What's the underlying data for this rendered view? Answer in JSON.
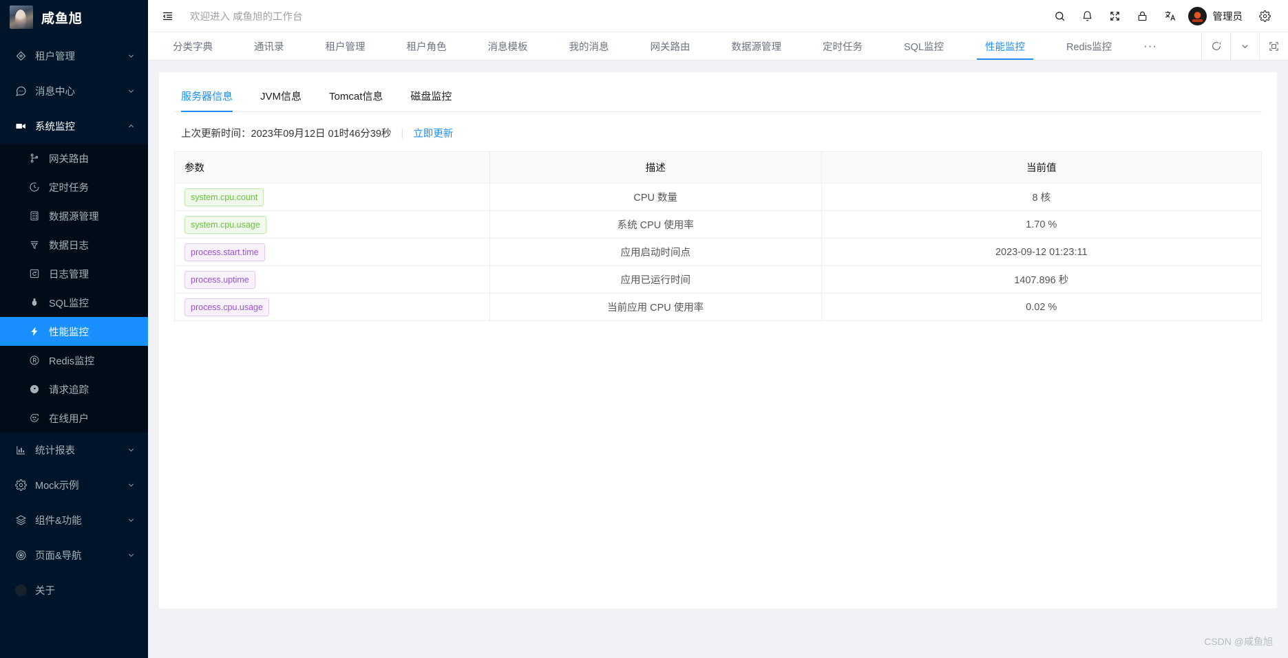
{
  "brand": {
    "name": "咸鱼旭",
    "logo_icon": "user-avatar-photo"
  },
  "sidebar": {
    "items": [
      {
        "label": "租户管理",
        "icon": "diamond-icon",
        "type": "group",
        "arrow": "chevron-down-icon"
      },
      {
        "label": "消息中心",
        "icon": "comment-dots-icon",
        "type": "group",
        "arrow": "chevron-down-icon"
      },
      {
        "label": "系统监控",
        "icon": "monitor-icon",
        "type": "group-open",
        "arrow": "chevron-up-icon"
      }
    ],
    "system_monitor_children": [
      {
        "label": "网关路由",
        "icon": "branch-icon",
        "active": false
      },
      {
        "label": "定时任务",
        "icon": "clock-icon",
        "active": false
      },
      {
        "label": "数据源管理",
        "icon": "database-icon",
        "active": false
      },
      {
        "label": "数据日志",
        "icon": "filter-icon",
        "active": false
      },
      {
        "label": "日志管理",
        "icon": "refresh-box-icon",
        "active": false
      },
      {
        "label": "SQL监控",
        "icon": "bug-icon",
        "active": false
      },
      {
        "label": "性能监控",
        "icon": "lightning-icon",
        "active": true
      },
      {
        "label": "Redis监控",
        "icon": "registered-icon",
        "active": false
      },
      {
        "label": "请求追踪",
        "icon": "compass-icon",
        "active": false
      },
      {
        "label": "在线用户",
        "icon": "smiley-icon",
        "active": false
      }
    ],
    "tail_items": [
      {
        "label": "统计报表",
        "icon": "bar-chart-icon",
        "type": "group",
        "arrow": "chevron-down-icon"
      },
      {
        "label": "Mock示例",
        "icon": "gear-icon",
        "type": "group",
        "arrow": "chevron-down-icon"
      },
      {
        "label": "组件&功能",
        "icon": "layers-icon",
        "type": "group",
        "arrow": "chevron-down-icon"
      },
      {
        "label": "页面&导航",
        "icon": "target-icon",
        "type": "group",
        "arrow": "chevron-down-icon"
      },
      {
        "label": "关于",
        "icon": "circle-dot-icon",
        "type": "leaf",
        "arrow": ""
      }
    ]
  },
  "topbar": {
    "collapse_icon": "menu-fold-icon",
    "welcome": "欢迎进入 咸鱼旭的工作台",
    "icons": [
      "search-icon",
      "bell-icon",
      "fullscreen-icon",
      "lock-icon",
      "translate-icon"
    ],
    "user_name": "管理员",
    "avatar_icon": "user-avatar",
    "settings_icon": "gear-icon"
  },
  "tabbar": {
    "tabs": [
      {
        "label": "分类字典",
        "active": false
      },
      {
        "label": "通讯录",
        "active": false
      },
      {
        "label": "租户管理",
        "active": false
      },
      {
        "label": "租户角色",
        "active": false
      },
      {
        "label": "消息模板",
        "active": false
      },
      {
        "label": "我的消息",
        "active": false
      },
      {
        "label": "网关路由",
        "active": false
      },
      {
        "label": "数据源管理",
        "active": false
      },
      {
        "label": "定时任务",
        "active": false
      },
      {
        "label": "SQL监控",
        "active": false
      },
      {
        "label": "性能监控",
        "active": true
      },
      {
        "label": "Redis监控",
        "active": false
      }
    ],
    "more_label": "···",
    "controls": [
      {
        "icon": "refresh-icon"
      },
      {
        "icon": "chevron-down-icon"
      },
      {
        "icon": "fullscreen-box-icon"
      }
    ]
  },
  "page": {
    "inner_tabs": [
      {
        "label": "服务器信息",
        "active": true
      },
      {
        "label": "JVM信息",
        "active": false
      },
      {
        "label": "Tomcat信息",
        "active": false
      },
      {
        "label": "磁盘监控",
        "active": false
      }
    ],
    "update_label": "上次更新时间：",
    "update_time": "2023年09月12日 01时46分39秒",
    "update_link": "立即更新",
    "table": {
      "columns": [
        "参数",
        "描述",
        "当前值"
      ],
      "rows": [
        {
          "param": "system.cpu.count",
          "tag_color": "green",
          "desc": "CPU 数量",
          "value": "8 核"
        },
        {
          "param": "system.cpu.usage",
          "tag_color": "green",
          "desc": "系统 CPU 使用率",
          "value": "1.70 %"
        },
        {
          "param": "process.start.time",
          "tag_color": "purple",
          "desc": "应用启动时间点",
          "value": "2023-09-12 01:23:11"
        },
        {
          "param": "process.uptime",
          "tag_color": "purple",
          "desc": "应用已运行时间",
          "value": "1407.896 秒"
        },
        {
          "param": "process.cpu.usage",
          "tag_color": "purple",
          "desc": "当前应用 CPU 使用率",
          "value": "0.02 %"
        }
      ]
    }
  },
  "watermark": "CSDN @咸鱼旭",
  "colors": {
    "sidebar_bg": "#001529",
    "submenu_bg": "#000c17",
    "accent": "#1890ff",
    "tag_green_text": "#67c23a",
    "tag_purple_text": "#9b4ddb",
    "page_bg": "#f0f2f5"
  }
}
